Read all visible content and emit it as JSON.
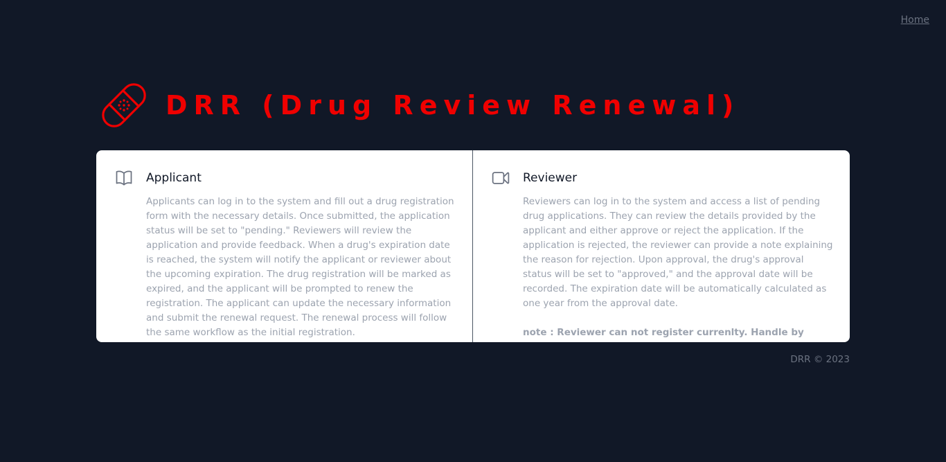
{
  "nav": {
    "home_label": "Home"
  },
  "hero": {
    "logo_icon": "bandage-icon",
    "title": "DRR (Drug Review Renewal)",
    "accent_color": "#ef0000"
  },
  "panels": [
    {
      "icon": "book-open-icon",
      "title": "Applicant",
      "description": "Applicants can log in to the system and fill out a drug registration form with the necessary details. Once submitted, the application status will be set to \"pending.\" Reviewers will review the application and provide feedback. When a drug's expiration date is reached, the system will notify the applicant or reviewer about the upcoming expiration. The drug registration will be marked as expired, and the applicant will be prompted to renew the registration. The applicant can update the necessary information and submit the renewal request. The renewal process will follow the same workflow as the initial registration."
    },
    {
      "icon": "video-camera-icon",
      "title": "Reviewer",
      "description": "Reviewers can log in to the system and access a list of pending drug applications. They can review the details provided by the applicant and either approve or reject the application. If the application is rejected, the reviewer can provide a note explaining the reason for rejection. Upon approval, the drug's approval status will be set to \"approved,\" and the approval date will be recorded. The expiration date will be automatically calculated as one year from the approval date.",
      "note": "note : Reviewer can not register currenlty. Handle by Admin"
    }
  ],
  "footer": {
    "text": "DRR © 2023"
  },
  "colors": {
    "background": "#111827",
    "card": "#ffffff",
    "muted_text": "#9ca3af"
  }
}
